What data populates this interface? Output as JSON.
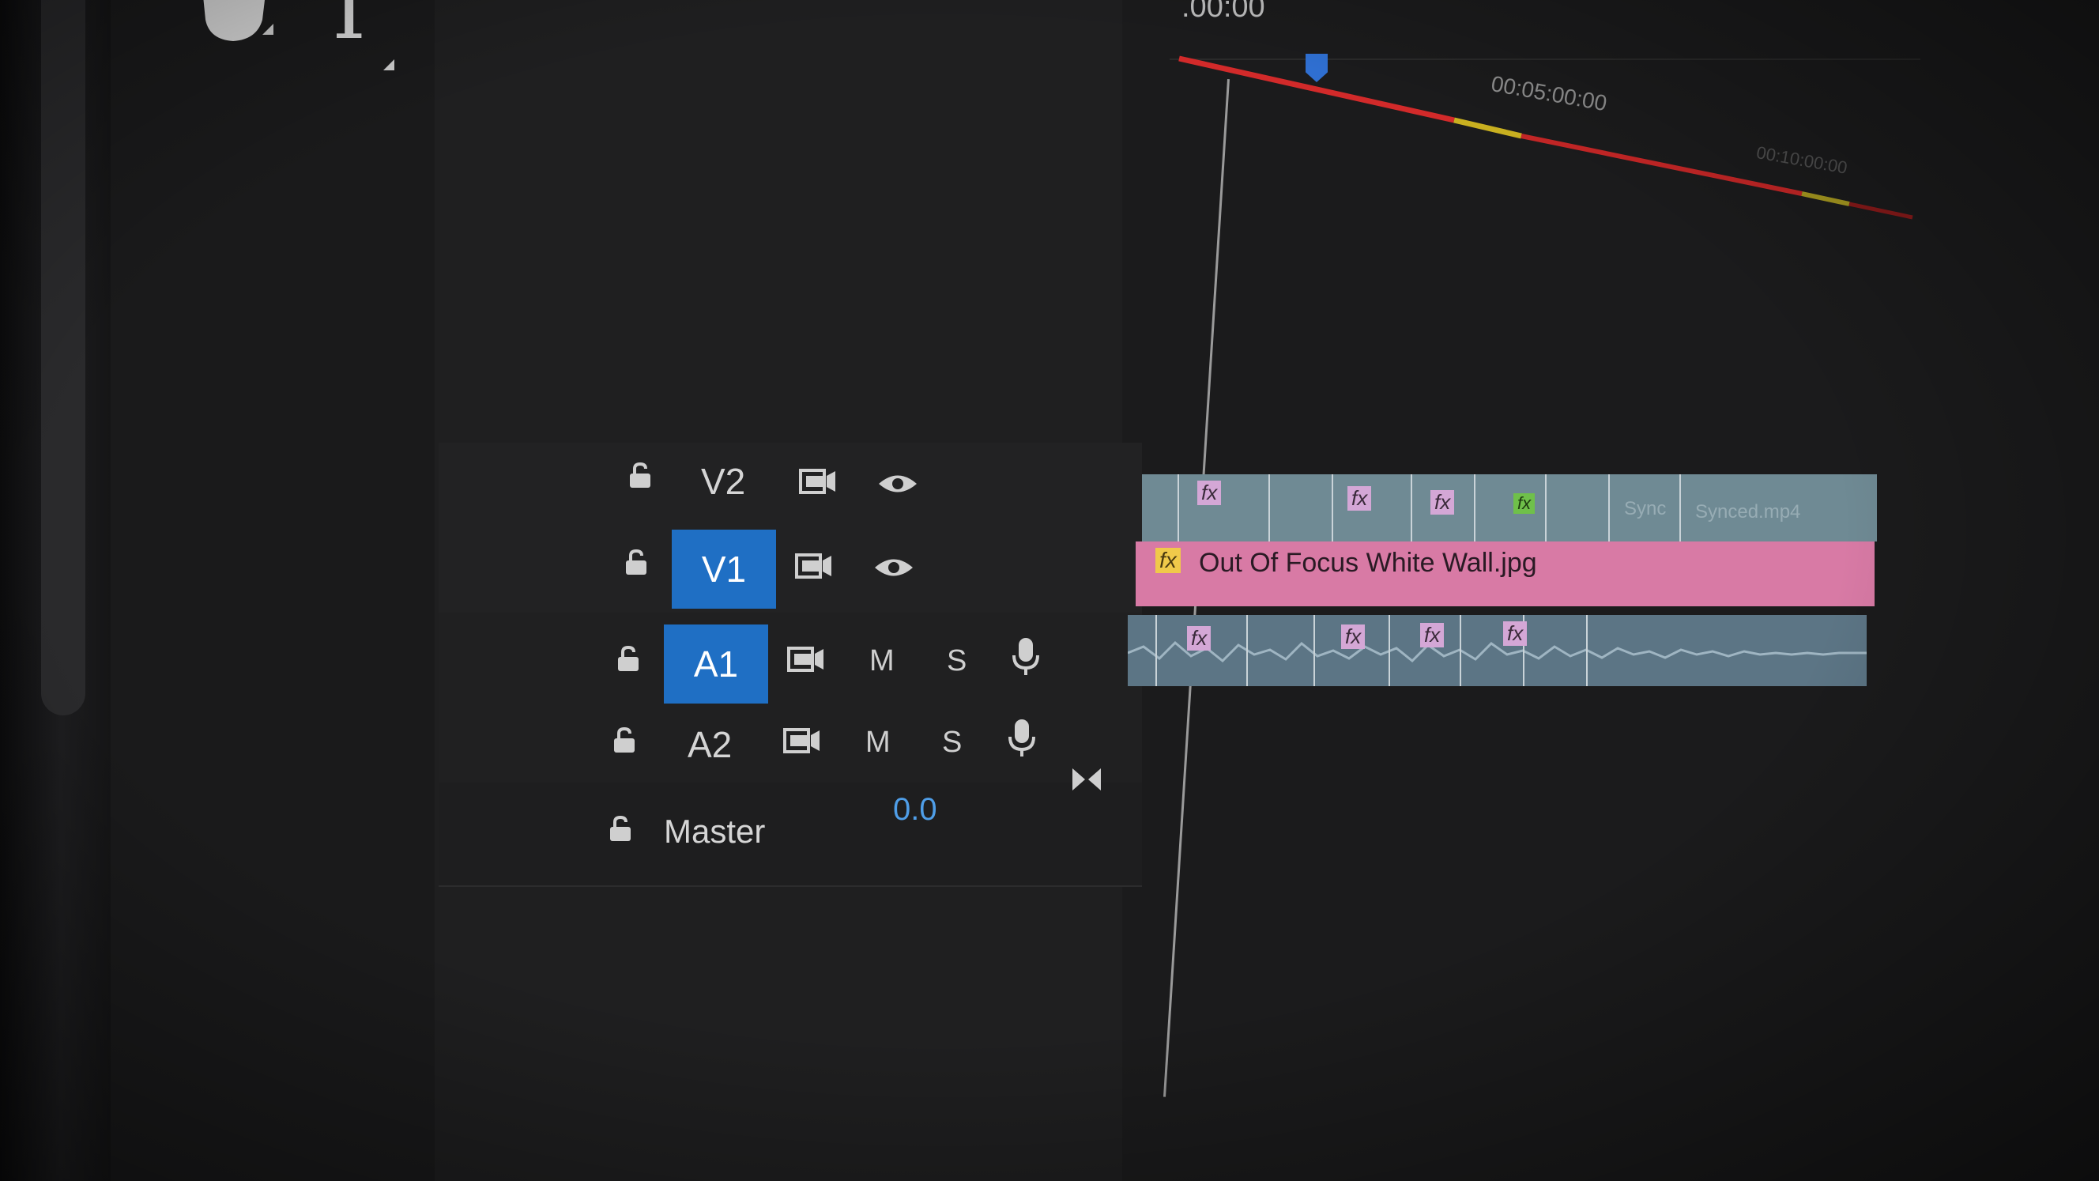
{
  "ruler": {
    "start_time": ".00:00",
    "mark_5min": "00:05:00:00",
    "mark_10min": "00:10:00:00"
  },
  "tools": {
    "hand": "hand-icon",
    "type": "T"
  },
  "tracks": [
    {
      "id": "v2",
      "label": "V2",
      "targeted": false,
      "icons": [
        "lock-icon",
        "sync-lock-icon",
        "eye-icon"
      ]
    },
    {
      "id": "v1",
      "label": "V1",
      "targeted": true,
      "icons": [
        "lock-icon",
        "sync-lock-icon",
        "eye-icon"
      ]
    },
    {
      "id": "a1",
      "label": "A1",
      "targeted": true,
      "mute": "M",
      "solo": "S",
      "icons": [
        "lock-icon",
        "sync-lock-icon",
        "mic-icon"
      ]
    },
    {
      "id": "a2",
      "label": "A2",
      "targeted": false,
      "mute": "M",
      "solo": "S",
      "icons": [
        "lock-icon",
        "sync-lock-icon",
        "mic-icon"
      ]
    }
  ],
  "master": {
    "label": "Master",
    "volume": "0.0"
  },
  "clips": {
    "v1": {
      "name": "Out Of Focus White Wall.jpg",
      "fx": "fx"
    },
    "v2": {
      "fx": "fx",
      "tail_1": "Sync",
      "tail_2": "Synced.mp4"
    },
    "a1": {
      "fx": "fx"
    }
  },
  "colors": {
    "target_blue": "#1f6fc4",
    "video_clip_pink": "#d87aa5",
    "video_clip_teal": "#6f8a94",
    "audio_clip": "#5c7585",
    "volume_blue": "#4f9ee8",
    "work_area_red": "#d22a2a",
    "render_yellow": "#c9b020"
  }
}
